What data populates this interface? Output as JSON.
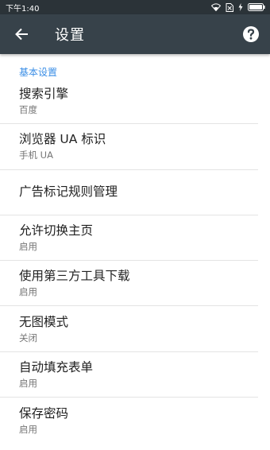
{
  "status_bar": {
    "time": "下午1:40"
  },
  "app_bar": {
    "title": "设置",
    "back_icon": "arrow-left",
    "help_icon": "question-circle"
  },
  "section": {
    "header": "基本设置"
  },
  "items": [
    {
      "title": "搜索引擎",
      "summary": "百度"
    },
    {
      "title": "浏览器 UA 标识",
      "summary": "手机 UA"
    },
    {
      "title": "广告标记规则管理",
      "summary": ""
    },
    {
      "title": "允许切换主页",
      "summary": "启用"
    },
    {
      "title": "使用第三方工具下载",
      "summary": "启用"
    },
    {
      "title": "无图模式",
      "summary": "关闭"
    },
    {
      "title": "自动填充表单",
      "summary": "启用"
    },
    {
      "title": "保存密码",
      "summary": "启用"
    }
  ],
  "colors": {
    "status_bar": "#2b3338",
    "app_bar": "#37424a",
    "accent": "#3a8ee6"
  }
}
